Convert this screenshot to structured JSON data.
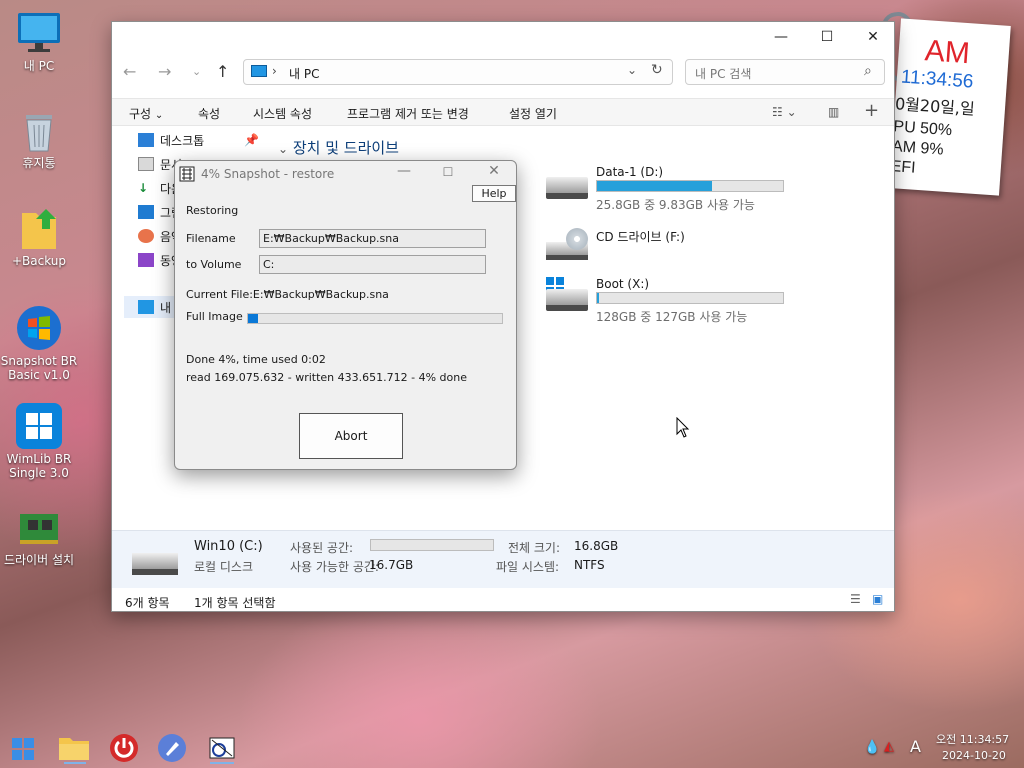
{
  "desktop": {
    "icons": [
      {
        "label": "내 PC"
      },
      {
        "label": "휴지통"
      },
      {
        "label": "+Backup"
      },
      {
        "label": "Snapshot BR Basic v1.0"
      },
      {
        "label": "WimLib BR Single 3.0"
      },
      {
        "label": "드라이버 설치"
      }
    ]
  },
  "widget": {
    "ampm": "AM",
    "time": "11:34:56",
    "date": "0월20일,일",
    "cpu": "PU  50%",
    "ram": "AM  9%",
    "efi": "EFI"
  },
  "explorer": {
    "address": "내 PC",
    "search_placeholder": "내 PC 검색",
    "commands": [
      "구성",
      "속성",
      "시스템 속성",
      "프로그램 제거 또는 변경",
      "설정 열기"
    ],
    "sidebar": [
      "데스크톱",
      "문서",
      "다운",
      "그림",
      "음악",
      "동영",
      "내"
    ],
    "group_title": "장치 및 드라이브",
    "drives": [
      {
        "name": "Data-1 (D:)",
        "free": "25.8GB 중 9.83GB 사용 가능",
        "used_fraction": 0.62
      },
      {
        "name": "CD 드라이브 (F:)",
        "free": "",
        "used_fraction": null
      },
      {
        "name": "Boot (X:)",
        "free": "128GB 중 127GB 사용 가능",
        "used_fraction": 0.01
      }
    ],
    "details": {
      "name": "Win10 (C:)",
      "type": "로컬 디스크",
      "used_label": "사용된 공간:",
      "free_label": "사용 가능한 공간:",
      "free_value": "16.7GB",
      "total_label": "전체 크기:",
      "total_value": "16.8GB",
      "fs_label": "파일 시스템:",
      "fs_value": "NTFS"
    },
    "status": {
      "count": "6개 항목",
      "selected": "1개 항목 선택함"
    }
  },
  "dialog": {
    "title": "4% Snapshot - restore",
    "help": "Help",
    "restoring": "Restoring",
    "filename_label": "Filename",
    "filename_value": "E:₩Backup₩Backup.sna",
    "volume_label": "to Volume",
    "volume_value": "C:",
    "current_file": "Current File:E:₩Backup₩Backup.sna",
    "full_image_label": "Full Image",
    "progress_fraction": 0.04,
    "done_text": "Done 4%, time used   0:02",
    "read_text": "read   169.075.632 - written   433.651.712 - 4% done",
    "abort": "Abort"
  },
  "taskbar": {
    "time": "오전 11:34:57",
    "date": "2024-10-20",
    "lang": "A"
  },
  "colors": {
    "accent": "#26a0da",
    "progress": "#0a78d7",
    "widget_red": "#e0242b",
    "widget_blue": "#1e6ad4"
  }
}
